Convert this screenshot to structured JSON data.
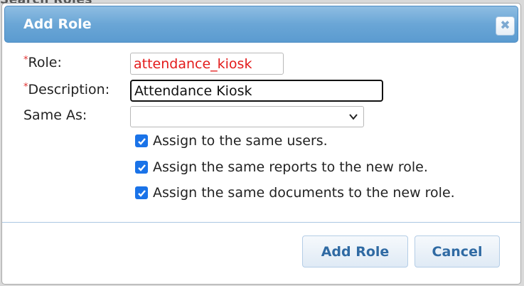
{
  "background": {
    "partial_text": "Search Roles"
  },
  "dialog": {
    "title": "Add Role",
    "close_glyph": "✖",
    "colors": {
      "titlebar": "#6aa6d6",
      "required": "#e03030",
      "role_value_text": "#e31b1b",
      "checkbox": "#1a73e8",
      "button_text": "#2f6aa3"
    }
  },
  "form": {
    "required_marker": "*",
    "role": {
      "label": "Role:",
      "value": "attendance_kiosk"
    },
    "description": {
      "label": "Description:",
      "value": "Attendance Kiosk"
    },
    "same_as": {
      "label": "Same As:",
      "selected": ""
    },
    "checkboxes": [
      {
        "label": "Assign to the same users.",
        "checked": true
      },
      {
        "label": "Assign the same reports to the new role.",
        "checked": true
      },
      {
        "label": "Assign the same documents to the new role.",
        "checked": true
      }
    ]
  },
  "buttons": {
    "add_label": "Add Role",
    "cancel_label": "Cancel"
  },
  "icons": {
    "close": "close-icon",
    "dropdown": "chevron-down-icon",
    "check": "checkmark-icon"
  }
}
